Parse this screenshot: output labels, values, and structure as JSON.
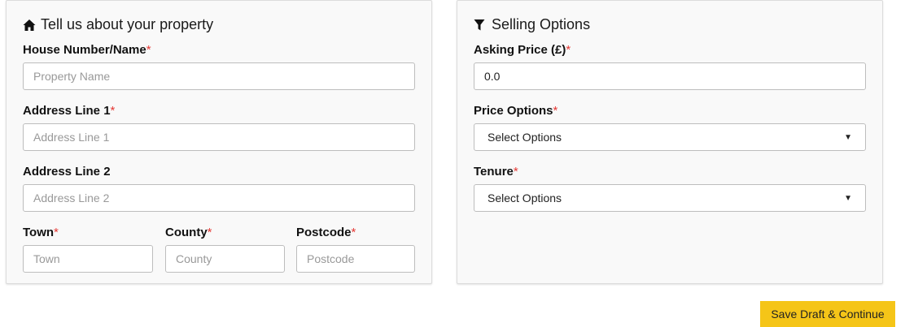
{
  "property": {
    "title": "Tell us about your property",
    "title_icon": "home-icon",
    "house_label": "House Number/Name",
    "house_placeholder": "Property Name",
    "address1_label": "Address Line 1",
    "address1_placeholder": "Address Line 1",
    "address2_label": "Address Line 2",
    "address2_placeholder": "Address Line 2",
    "town_label": "Town",
    "town_placeholder": "Town",
    "county_label": "County",
    "county_placeholder": "County",
    "postcode_label": "Postcode",
    "postcode_placeholder": "Postcode"
  },
  "selling": {
    "title": "Selling Options",
    "title_icon": "filter-icon",
    "asking_label": "Asking Price (£)",
    "asking_value": "0.0",
    "price_options_label": "Price Options",
    "price_options_value": "Select Options",
    "tenure_label": "Tenure",
    "tenure_value": "Select Options"
  },
  "required_marker": "*",
  "actions": {
    "save_label": "Save Draft & Continue"
  },
  "colors": {
    "required": "#e53935",
    "button": "#f5c518",
    "panel_bg": "#f9f9f9"
  }
}
